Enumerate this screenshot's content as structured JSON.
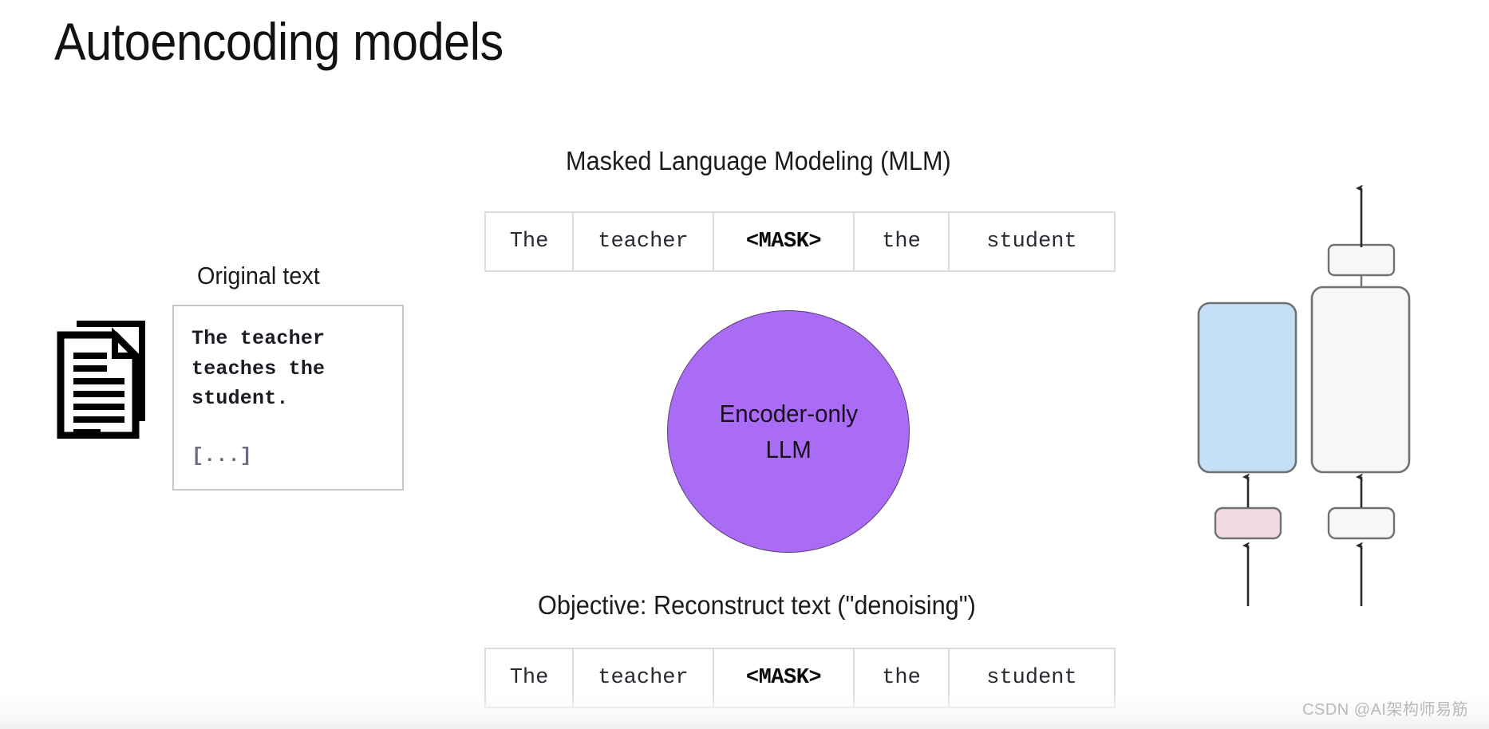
{
  "slide": {
    "title": "Autoencoding models"
  },
  "left_panel": {
    "label": "Original text",
    "doc_icon_name": "document-stack-icon",
    "text_box": {
      "lines": [
        "The teacher",
        "teaches the",
        "student."
      ],
      "ellipsis": "[...]"
    }
  },
  "center_panel": {
    "mlm_heading": "Masked Language Modeling (MLM)",
    "objective_heading": "Objective: Reconstruct text (\"denoising\")",
    "tokens_top": [
      "The",
      "teacher",
      "<MASK>",
      "the",
      "student"
    ],
    "tokens_bottom": [
      "The",
      "teacher",
      "<MASK>",
      "the",
      "student"
    ],
    "encoder": {
      "line1": "Encoder-only",
      "line2": "LLM"
    }
  },
  "right_panel": {
    "blocks": [
      {
        "name": "encoder-block",
        "color": "#c5dff7"
      },
      {
        "name": "decoder-block",
        "color": "#f7f7f7"
      },
      {
        "name": "encoder-input-embedding",
        "color": "#f2dae2"
      },
      {
        "name": "decoder-input-embedding",
        "color": "#f7f7f7"
      },
      {
        "name": "output-head",
        "color": "#f7f7f7"
      }
    ]
  },
  "watermark": {
    "text": "CSDN @AI架构师易筋"
  },
  "colors": {
    "encoder_circle": "#ab6cf5",
    "encoder_circle_border": "#5a4070",
    "token_border": "#dcdcdc",
    "text_box_border": "#c6c6c6",
    "blue_block": "#c5dff7",
    "pink_block": "#f2dae2",
    "gray_block": "#f7f7f7",
    "block_border": "#6e7277",
    "title_color": "#121212",
    "watermark_color": "#b9b9b9"
  }
}
